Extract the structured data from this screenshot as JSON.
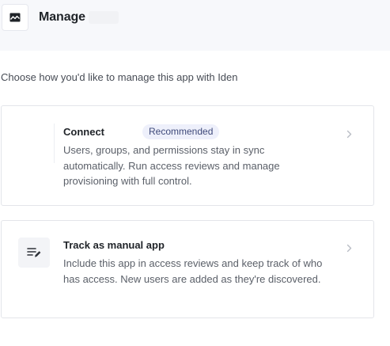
{
  "header": {
    "title": "Manage"
  },
  "subtitle": "Choose how you'd like to manage this app with Iden",
  "options": [
    {
      "title": "Connect",
      "badge": "Recommended",
      "description": "Users, groups, and permissions stay in sync automatically. Run access reviews and manage provisioning with full control."
    },
    {
      "title": "Track as manual app",
      "description": "Include this app in access reviews and keep track of who has access. New users are added as they're discovered."
    }
  ],
  "icons": {
    "app": "image-icon",
    "manual": "edit-list-icon",
    "chevron": "chevron-right-icon"
  },
  "colors": {
    "badge_bg": "#eef0fb",
    "badge_text": "#3f4a7a",
    "header_bg": "#f7f8fb"
  }
}
